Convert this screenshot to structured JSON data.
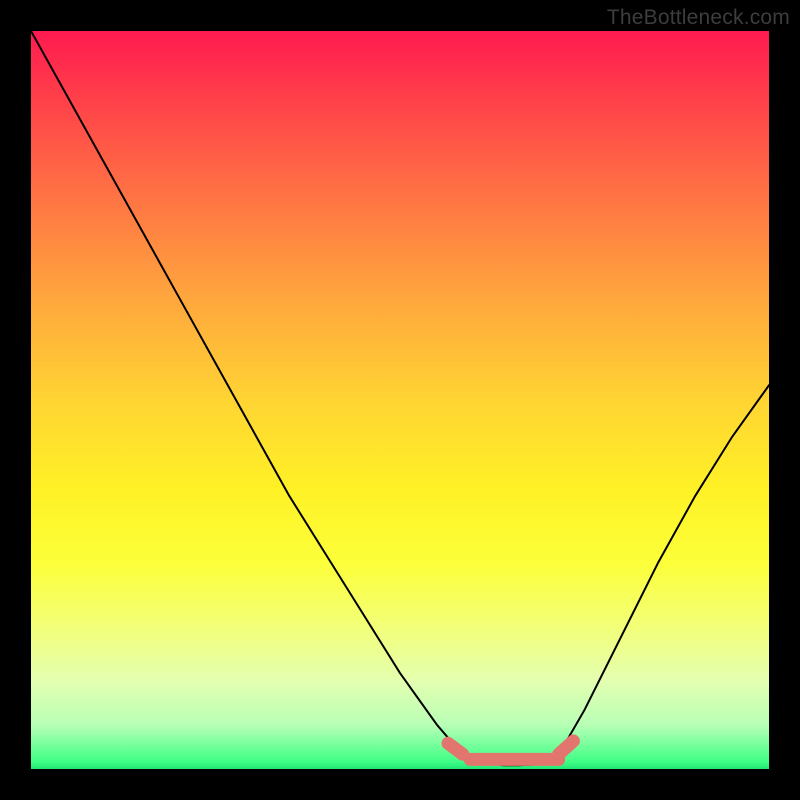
{
  "watermark": "TheBottleneck.com",
  "chart_data": {
    "type": "line",
    "title": "",
    "xlabel": "",
    "ylabel": "",
    "xlim": [
      0,
      100
    ],
    "ylim": [
      0,
      100
    ],
    "grid": false,
    "series": [
      {
        "name": "curve",
        "x": [
          0,
          5,
          10,
          15,
          20,
          25,
          30,
          35,
          40,
          45,
          50,
          55,
          58,
          60,
          62,
          64,
          66,
          68,
          70,
          72,
          75,
          80,
          85,
          90,
          95,
          100
        ],
        "values": [
          100,
          91,
          82,
          73,
          64,
          55,
          46,
          37,
          29,
          21,
          13,
          6,
          2.5,
          1.3,
          0.8,
          0.5,
          0.5,
          0.6,
          1.2,
          2.8,
          8,
          18,
          28,
          37,
          45,
          52
        ]
      }
    ],
    "highlight": {
      "name": "bottom-band",
      "color": "#e2766f",
      "segments": [
        {
          "x": [
            56.5,
            58.5
          ],
          "values": [
            3.5,
            2.0
          ]
        },
        {
          "x": [
            59.5,
            71.5
          ],
          "values": [
            1.3,
            1.3
          ]
        },
        {
          "x": [
            71.5,
            73.5
          ],
          "values": [
            2.0,
            3.8
          ]
        }
      ]
    },
    "background_gradient": {
      "stops": [
        {
          "pos": 0.0,
          "color": "#ff1a50"
        },
        {
          "pos": 0.35,
          "color": "#ffa23e"
        },
        {
          "pos": 0.62,
          "color": "#fff126"
        },
        {
          "pos": 0.99,
          "color": "#40ff86"
        }
      ]
    }
  }
}
